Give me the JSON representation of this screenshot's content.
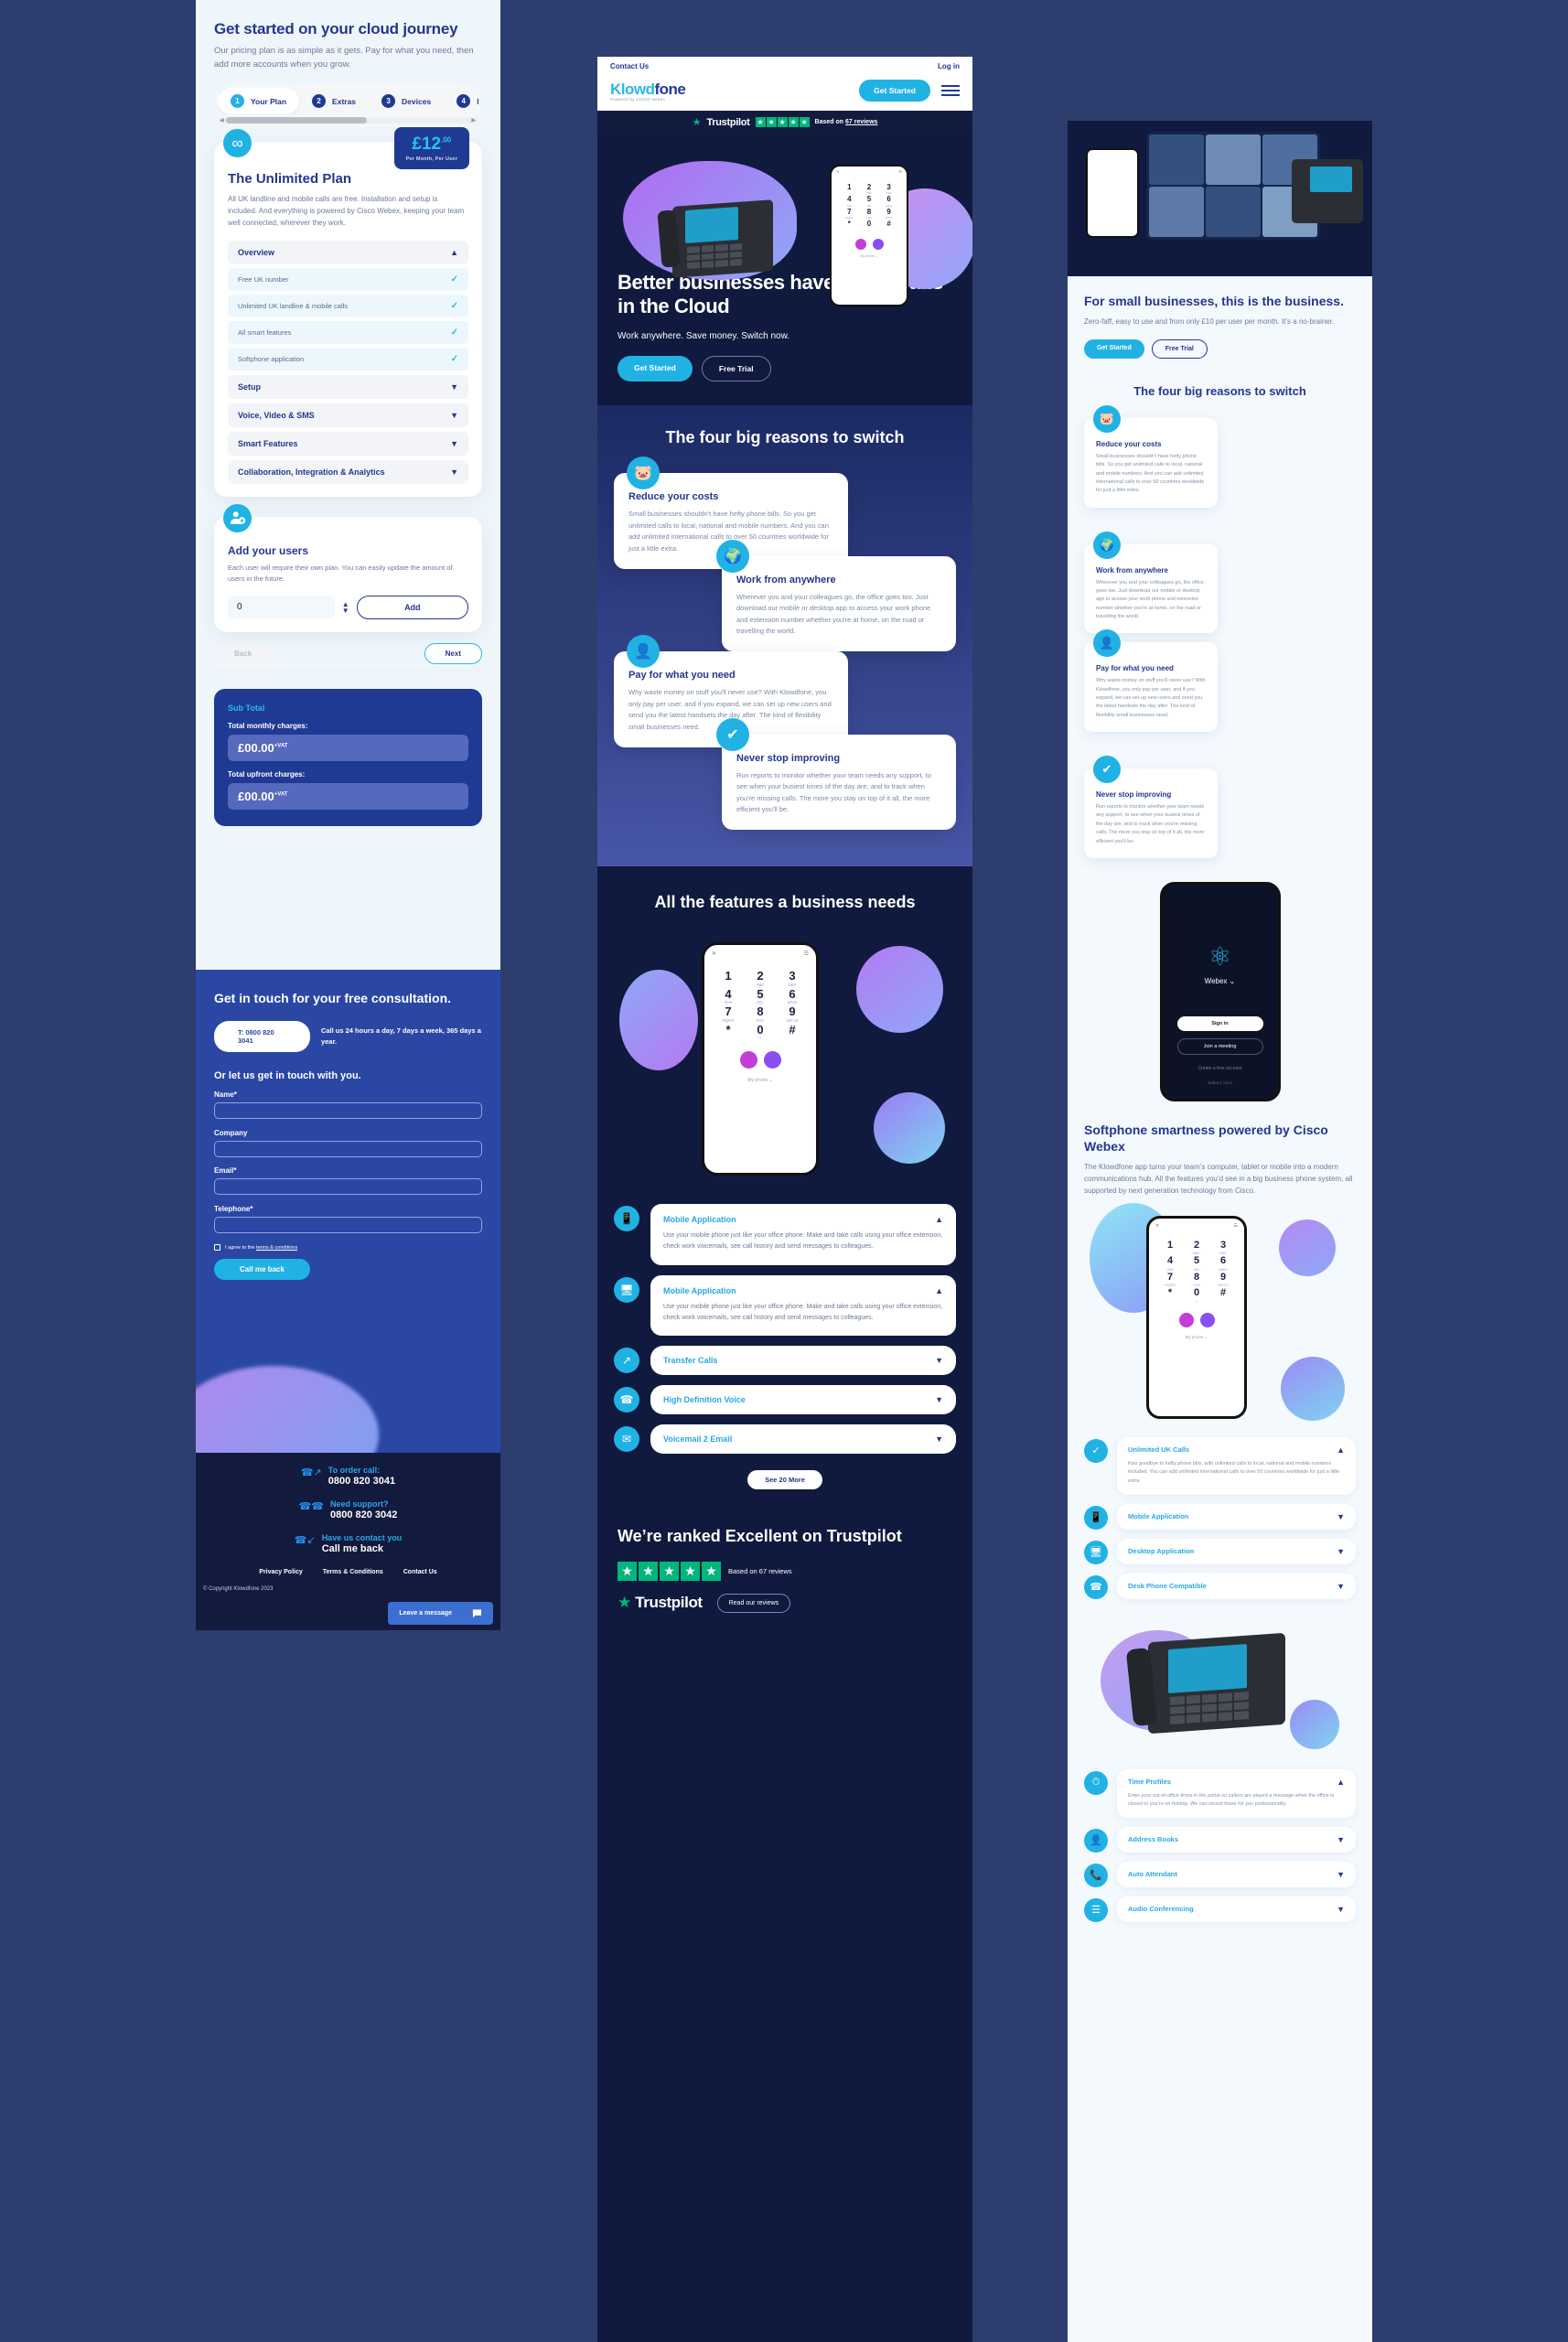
{
  "col1": {
    "title": "Get started on your cloud journey",
    "subtitle": "Our pricing plan is as simple as it gets. Pay for what you need, then add more accounts when you grow.",
    "steps": [
      {
        "num": "1",
        "label": "Your Plan"
      },
      {
        "num": "2",
        "label": "Extras"
      },
      {
        "num": "3",
        "label": "Devices"
      },
      {
        "num": "4",
        "label": "N"
      }
    ],
    "plan": {
      "icon": "infinity-icon",
      "price_amount": "£12",
      "price_decimals": ".00",
      "price_label": "Per Month, Per User",
      "name": "The Unlimited Plan",
      "description": "All UK landline and mobile calls are free. Installation and setup is included. And everything is powered by Cisco Webex, keeping your team well connected, wherever they work."
    },
    "accordion": {
      "overview_label": "Overview",
      "overview_items": [
        "Free UK number",
        "Unlimited UK landline & mobile calls",
        "All smart features",
        "Softphone application"
      ],
      "sections": [
        "Setup",
        "Voice, Video & SMS",
        "Smart Features",
        "Collaboration, Integration & Analytics"
      ]
    },
    "users": {
      "title": "Add your users",
      "description": "Each user will require their own plan. You can easily update the amount of users in the future.",
      "quantity": "0",
      "add_label": "Add"
    },
    "nav": {
      "back": "Back",
      "next": "Next"
    },
    "subtotal": {
      "title": "Sub Total",
      "monthly_label": "Total monthly charges:",
      "monthly_value": "£00.00",
      "monthly_vat": "+VAT",
      "upfront_label": "Total upfront charges:",
      "upfront_value": "£00.00",
      "upfront_vat": "+VAT"
    },
    "contact": {
      "title": "Get in touch for your free consultation.",
      "phone": "T: 0800 820 3041",
      "note": "Call us 24 hours a day, 7 days a week, 365 days a year.",
      "subtitle": "Or let us get in touch with you.",
      "fields": [
        "Name*",
        "Company",
        "Email*",
        "Telephone*"
      ],
      "consent_pre": "I agree to the ",
      "consent_link": "terms & conditions",
      "submit": "Call me back"
    },
    "footer": {
      "blocks": [
        {
          "icon": "phone-out-icon",
          "label": "To order call:",
          "value": "0800 820 3041"
        },
        {
          "icon": "support-icon",
          "label": "Need support?",
          "value": "0800 820 3042"
        },
        {
          "icon": "phone-in-icon",
          "label": "Have us contact you",
          "value": "Call me back"
        }
      ],
      "links": [
        "Privacy Policy",
        "Terms & Conditions",
        "Contact Us"
      ],
      "copyright": "© Copyright Klowdfone 2023",
      "chat_label": "Leave a message"
    }
  },
  "col2": {
    "topbar": {
      "contact": "Contact Us",
      "login": "Log in"
    },
    "logo": {
      "part1": "Klowd",
      "part2": "fone",
      "tagline": "Powered by CISCO webex"
    },
    "get_started": "Get Started",
    "trustpilot": {
      "name": "Trustpilot",
      "stars": 5,
      "based_on_pre": "Based on ",
      "based_on_link": "67 reviews"
    },
    "hero": {
      "headline": "Better businesses have their heads in the Cloud",
      "subline": "Work anywhere. Save money. Switch now.",
      "primary": "Get Started",
      "secondary": "Free Trial"
    },
    "keypad": [
      {
        "n": "1",
        "s": ""
      },
      {
        "n": "2",
        "s": "ABC"
      },
      {
        "n": "3",
        "s": "DEF"
      },
      {
        "n": "4",
        "s": "GHI"
      },
      {
        "n": "5",
        "s": "JKL"
      },
      {
        "n": "6",
        "s": "MNO"
      },
      {
        "n": "7",
        "s": "PQRS"
      },
      {
        "n": "8",
        "s": "TUV"
      },
      {
        "n": "9",
        "s": "WXYZ"
      },
      {
        "n": "*",
        "s": ""
      },
      {
        "n": "0",
        "s": "+"
      },
      {
        "n": "#",
        "s": ""
      }
    ],
    "phone_footer": "My phone ⌄",
    "reasons_heading": "The four big reasons to switch",
    "reasons": [
      {
        "icon": "piggy-bank-icon",
        "title": "Reduce your costs",
        "description": "Small businesses shouldn't have hefty phone bills. So you get unlimited calls to local, national and mobile numbers. And you can add unlimited international calls to over 50 countries worldwide for just a little extra."
      },
      {
        "icon": "globe-icon",
        "title": "Work from anywhere",
        "description": "Wherever you and your colleagues go, the office goes too. Just download our mobile or desktop app to access your work phone and extension number whether you're at home, on the road or travelling the world."
      },
      {
        "icon": "add-user-icon",
        "title": "Pay for what you need",
        "description": "Why waste money on stuff you'll never use? With Klowdfone, you only pay per user, and if you expand, we can set up new users and send you the latest handsets the day after. The kind of flexibility small businesses need."
      },
      {
        "icon": "badge-check-icon",
        "title": "Never stop improving",
        "description": "Run reports to monitor whether your team needs any support, to see when your busiest times of the day are, and to track when you're missing calls. The more you stay on top of it all, the more efficient you'll be."
      }
    ],
    "features_heading": "All the features a business needs",
    "features": [
      {
        "icon": "mobile-icon",
        "title": "Mobile Application",
        "open": true,
        "description": "Use your mobile phone just like your office phone. Make and take calls using your office extension, check work voicemails, see call history and send messages to colleagues."
      },
      {
        "icon": "desktop-icon",
        "title": "Mobile Application",
        "open": true,
        "description": "Use your mobile phone just like your office phone. Make and take calls using your office extension, check work voicemails, see call history and send messages to colleagues."
      },
      {
        "icon": "transfer-call-icon",
        "title": "Transfer Calls",
        "open": false,
        "description": ""
      },
      {
        "icon": "hd-voice-icon",
        "title": "High Definition Voice",
        "open": false,
        "description": ""
      },
      {
        "icon": "voicemail-icon",
        "title": "Voicemail 2 Email",
        "open": false,
        "description": ""
      }
    ],
    "see_more": "See 20 More",
    "ranked": {
      "heading": "We’re ranked Excellent on Trustpilot",
      "stars": 5,
      "based_on": "Based on 67 reviews",
      "logo_name": "Trustpilot",
      "read_reviews": "Read our reviews"
    }
  },
  "col3": {
    "hero": {
      "title": "For small businesses, this is the business.",
      "description": "Zero-faff, easy to use and from only £10 per user per month. It’s a no-brainer.",
      "primary": "Get Started",
      "secondary": "Free Trial"
    },
    "reasons_heading": "The four big reasons to switch",
    "reasons": [
      {
        "icon": "piggy-bank-icon",
        "title": "Reduce your costs",
        "description": "Small businesses shouldn't have hefty phone bills. So you get unlimited calls to local, national and mobile numbers. And you can add unlimited international calls to over 50 countries worldwide for just a little extra."
      },
      {
        "icon": "globe-icon",
        "title": "Work from anywhere",
        "description": "Wherever you and your colleagues go, the office goes too. Just download our mobile or desktop app to access your work phone and extension number whether you're at home, on the road or travelling the world."
      },
      {
        "icon": "add-user-icon",
        "title": "Pay for what you need",
        "description": "Why waste money on stuff you'll never use? With Klowdfone, you only pay per user, and if you expand, we can set up new users and send you the latest handsets the day after. The kind of flexibility small businesses need."
      },
      {
        "icon": "badge-check-icon",
        "title": "Never stop improving",
        "description": "Run reports to monitor whether your team needs any support, to see when your busiest times of the day are, and to track when you're missing calls. The more you stay on top of it all, the more efficient you'll be."
      }
    ],
    "webex": {
      "logo": "webex-icon",
      "name": "Webex ⌄",
      "sign_in": "Sign in",
      "join_meeting": "Join a meeting",
      "create_account": "Create a free account",
      "footer": "webex | cisco"
    },
    "softphone": {
      "title": "Softphone smartness powered by Cisco Webex",
      "description": "The Klowdfone app turns your team’s computer, tablet or mobile into a modern communications hub. All the features you’d see in a big business phone system, all supported by next generation technology from Cisco."
    },
    "accordion_top": [
      {
        "icon": "tick-icon",
        "title": "Unlimited UK Calls",
        "open": true,
        "description": "Kiss goodbye to hefty phone bills, with unlimited calls to local, national and mobile numbers included. You can add unlimited international calls to over 50 countries worldwide for just a little extra."
      },
      {
        "icon": "mobile-icon",
        "title": "Mobile Application",
        "open": false,
        "description": ""
      },
      {
        "icon": "desktop-icon",
        "title": "Desktop Application",
        "open": false,
        "description": ""
      },
      {
        "icon": "desk-phone-icon",
        "title": "Desk Phone Compatible",
        "open": false,
        "description": ""
      }
    ],
    "accordion_bottom": [
      {
        "icon": "clock-icon",
        "title": "Time Profiles",
        "open": true,
        "description": "Enter your out-of-office times in the portal so callers are played a message when the office is closed or you’re on holiday. We can record these for you professionally."
      },
      {
        "icon": "address-book-icon",
        "title": "Address Books",
        "open": false,
        "description": ""
      },
      {
        "icon": "auto-attendant-icon",
        "title": "Auto Attendant",
        "open": false,
        "description": ""
      },
      {
        "icon": "audio-conf-icon",
        "title": "Audio Conferencing",
        "open": false,
        "description": ""
      }
    ]
  }
}
